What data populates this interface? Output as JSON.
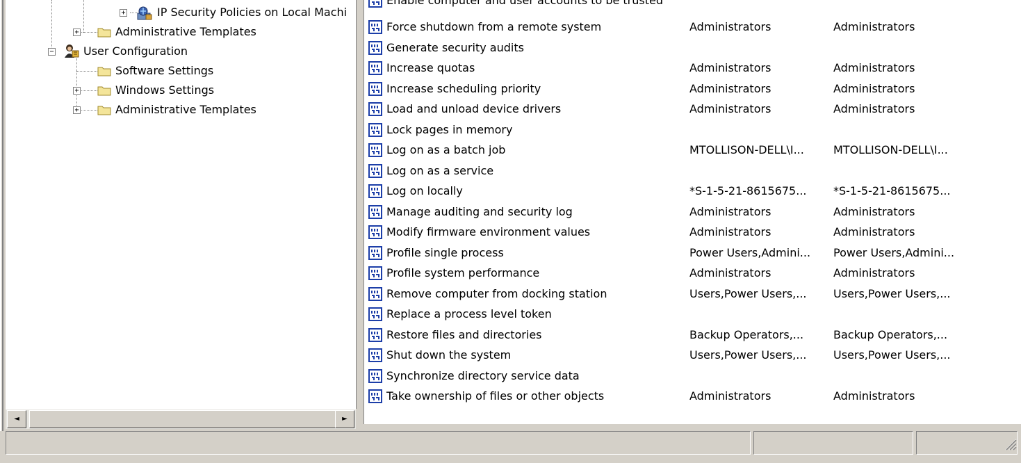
{
  "tree": {
    "items": [
      {
        "label": "IP Security Policies on Local Machi",
        "icon": "ip-security-policy-icon",
        "expander": "+"
      },
      {
        "label": "Administrative Templates",
        "icon": "folder-icon",
        "expander": "+"
      },
      {
        "label": "User Configuration",
        "icon": "user-configuration-icon",
        "expander": "−"
      },
      {
        "label": "Software Settings",
        "icon": "folder-icon",
        "expander": ""
      },
      {
        "label": "Windows Settings",
        "icon": "folder-icon",
        "expander": "+"
      },
      {
        "label": "Administrative Templates",
        "icon": "folder-icon",
        "expander": "+"
      }
    ]
  },
  "list": {
    "partial_row": "Enable computer and user accounts to be trusted",
    "rows": [
      {
        "policy": "Force shutdown from a remote system",
        "local": "Administrators",
        "effective": "Administrators"
      },
      {
        "policy": "Generate security audits",
        "local": "",
        "effective": ""
      },
      {
        "policy": "Increase quotas",
        "local": "Administrators",
        "effective": "Administrators"
      },
      {
        "policy": "Increase scheduling priority",
        "local": "Administrators",
        "effective": "Administrators"
      },
      {
        "policy": "Load and unload device drivers",
        "local": "Administrators",
        "effective": "Administrators"
      },
      {
        "policy": "Lock pages in memory",
        "local": "",
        "effective": ""
      },
      {
        "policy": "Log on as a batch job",
        "local": "MTOLLISON-DELL\\I...",
        "effective": "MTOLLISON-DELL\\I..."
      },
      {
        "policy": "Log on as a service",
        "local": "",
        "effective": ""
      },
      {
        "policy": "Log on locally",
        "local": "*S-1-5-21-8615675...",
        "effective": "*S-1-5-21-8615675..."
      },
      {
        "policy": "Manage auditing and security log",
        "local": "Administrators",
        "effective": "Administrators"
      },
      {
        "policy": "Modify firmware environment values",
        "local": "Administrators",
        "effective": "Administrators"
      },
      {
        "policy": "Profile single process",
        "local": "Power Users,Admini...",
        "effective": "Power Users,Admini..."
      },
      {
        "policy": "Profile system performance",
        "local": "Administrators",
        "effective": "Administrators"
      },
      {
        "policy": "Remove computer from docking station",
        "local": "Users,Power Users,...",
        "effective": "Users,Power Users,..."
      },
      {
        "policy": "Replace a process level token",
        "local": "",
        "effective": ""
      },
      {
        "policy": "Restore files and directories",
        "local": "Backup Operators,...",
        "effective": "Backup Operators,..."
      },
      {
        "policy": "Shut down the system",
        "local": "Users,Power Users,...",
        "effective": "Users,Power Users,..."
      },
      {
        "policy": "Synchronize directory service data",
        "local": "",
        "effective": ""
      },
      {
        "policy": "Take ownership of files or other objects",
        "local": "Administrators",
        "effective": "Administrators"
      }
    ]
  },
  "scrollbar": {
    "left_arrow": "◄",
    "right_arrow": "►"
  },
  "colors": {
    "folder": "#f4e59a",
    "folder_edge": "#a08a2c",
    "policy_icon": "#1c3ea8",
    "window_face": "#d4d0c8"
  }
}
